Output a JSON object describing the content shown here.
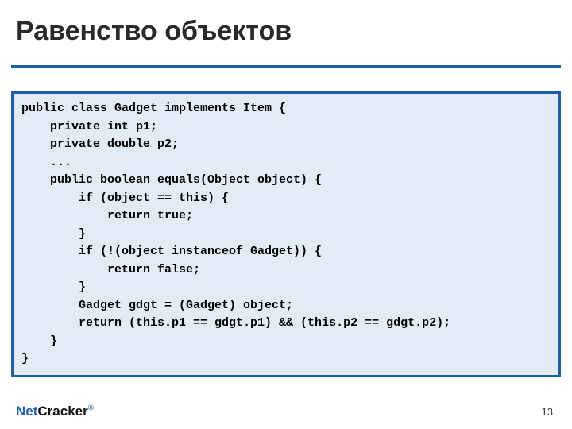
{
  "slide": {
    "title": "Равенство объектов",
    "page_number": "13",
    "logo": {
      "part1": "Net",
      "part2": "Cracker",
      "mark": "®"
    },
    "code": "public class Gadget implements Item {\n    private int p1;\n    private double p2;\n    ...\n    public boolean equals(Object object) {\n        if (object == this) {\n            return true;\n        }\n        if (!(object instanceof Gadget)) {\n            return false;\n        }\n        Gadget gdgt = (Gadget) object;\n        return (this.p1 == gdgt.p1) && (this.p2 == gdgt.p2);\n    }\n}",
    "accent_color": "#1e5fa6"
  }
}
